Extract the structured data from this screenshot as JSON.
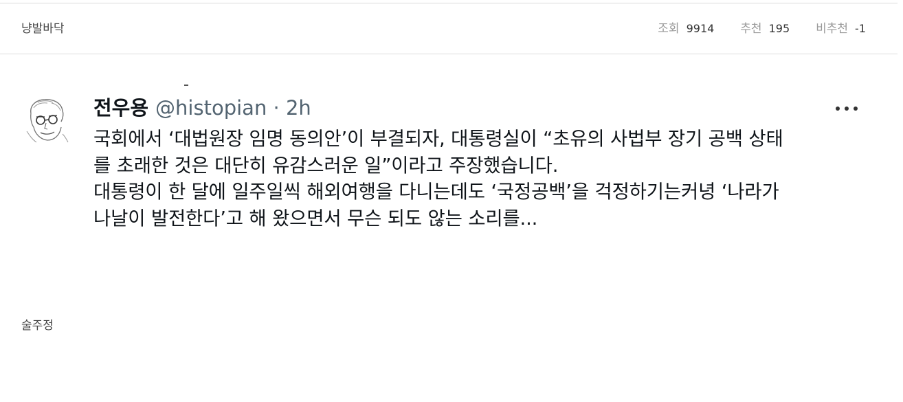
{
  "post": {
    "author": "냥발바닥",
    "stats": {
      "views_label": "조회",
      "views_value": "9914",
      "likes_label": "추천",
      "likes_value": "195",
      "dislikes_label": "비추천",
      "dislikes_value": "-1"
    }
  },
  "tweet": {
    "display_name": "전우용",
    "handle_time": "@histopian · 2h",
    "more_icon": "more-horizontal-icon",
    "lines": [
      "국회에서 ‘대법원장 임명 동의안’이 부결되자, 대통령실이 “초유의 사법부 장기 공백 상태",
      "를 초래한 것은 대단히 유감스러운 일”이라고 주장했습니다.",
      "대통령이 한 달에 일주일씩 해외여행을 다니는데도 ‘국정공백’을 걱정하기는커녕 ‘나라가",
      "나날이 발전한다’고 해 왔으면서 무슨 되도 않는 소리를..."
    ]
  },
  "comment": {
    "author": "술주정"
  }
}
